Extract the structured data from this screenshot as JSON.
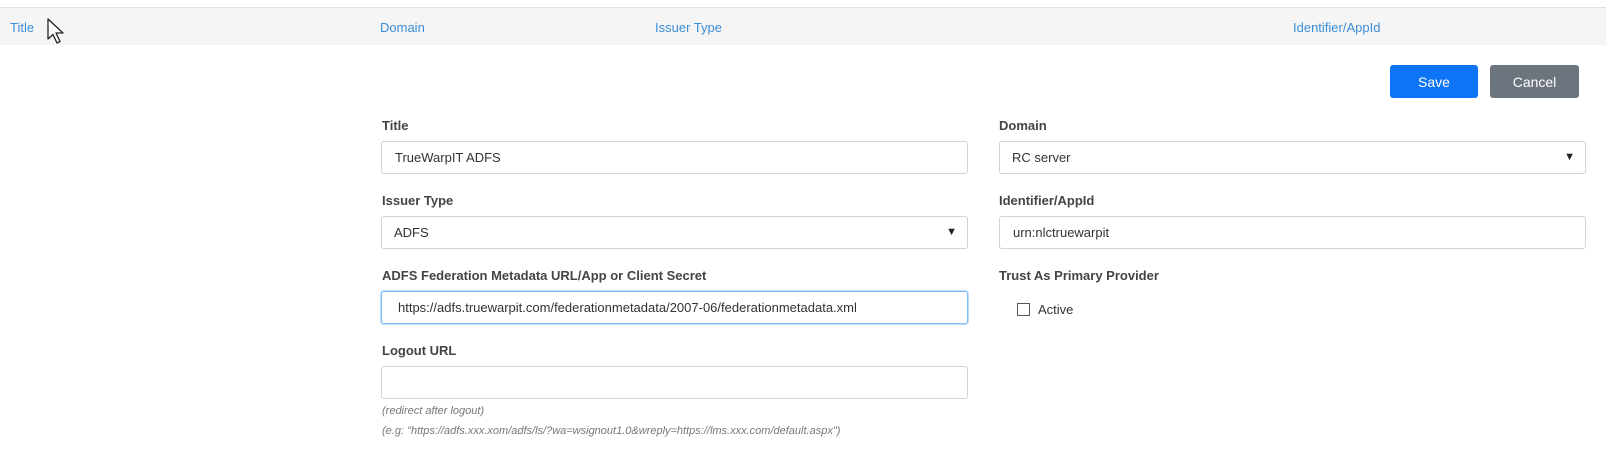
{
  "columns": {
    "title": "Title",
    "domain": "Domain",
    "issuer_type": "Issuer Type",
    "identifier": "Identifier/AppId"
  },
  "buttons": {
    "save": "Save",
    "cancel": "Cancel"
  },
  "form": {
    "title": {
      "label": "Title",
      "value": "TrueWarpIT ADFS"
    },
    "domain": {
      "label": "Domain",
      "selected": "RC server"
    },
    "issuer_type": {
      "label": "Issuer Type",
      "selected": "ADFS"
    },
    "identifier": {
      "label": "Identifier/AppId",
      "value": "urn:nlctruewarpit"
    },
    "metadata": {
      "label": "ADFS Federation Metadata URL/App or Client Secret",
      "value": "https://adfs.truewarpit.com/federationmetadata/2007-06/federationmetadata.xml"
    },
    "trust_primary": {
      "label": "Trust As Primary Provider",
      "checkbox_label": "Active",
      "checked": false
    },
    "logout_url": {
      "label": "Logout URL",
      "value": "",
      "hint_1": "(redirect after logout)",
      "hint_2": "(e.g: \"https://adfs.xxx.xom/adfs/ls/?wa=wsignout1.0&wreply=https://lms.xxx.com/default.aspx\")"
    }
  },
  "icons": {
    "select_caret": "caret-down-icon",
    "cursor": "mouse-pointer-icon"
  },
  "colors": {
    "link": "#3b8ed8",
    "primary": "#0d74f5",
    "secondary": "#6c757d",
    "focus": "#80bdff"
  }
}
